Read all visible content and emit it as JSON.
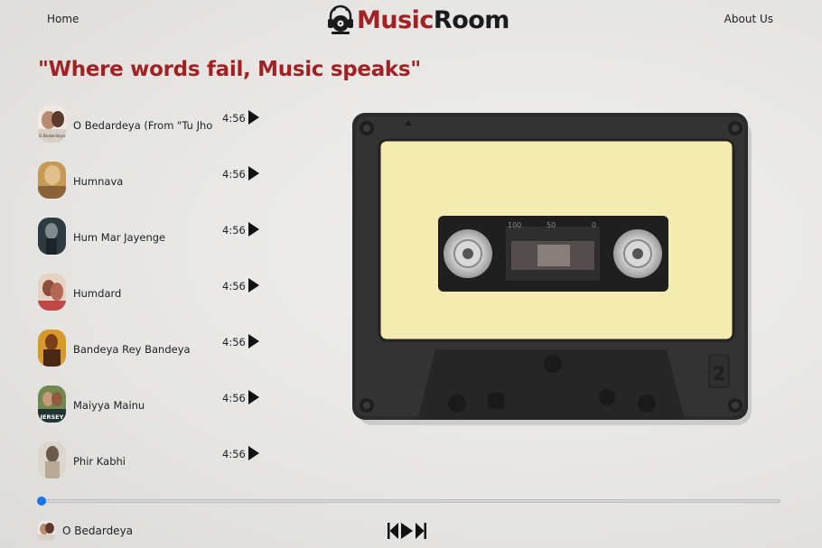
{
  "nav": {
    "home_label": "Home",
    "about_label": "About Us",
    "brand_part1": "Music",
    "brand_part2": "Room"
  },
  "quote": "\"Where words fail, Music speaks\"",
  "songs": [
    {
      "title": "O Bedardeya (From \"Tu Jhoothi Main Makkaar\")",
      "duration": "4:56"
    },
    {
      "title": "Humnava",
      "duration": "4:56"
    },
    {
      "title": "Hum Mar Jayenge",
      "duration": "4:56"
    },
    {
      "title": "Humdard",
      "duration": "4:56"
    },
    {
      "title": "Bandeya Rey Bandeya",
      "duration": "4:56"
    },
    {
      "title": "Maiyya Mainu",
      "duration": "4:56"
    },
    {
      "title": "Phir Kabhi",
      "duration": "4:56"
    }
  ],
  "cover_labels": {
    "song0": "O Bedardeya",
    "song5": "JERSEY"
  },
  "player": {
    "progress_percent": 0,
    "now_playing_title": "O Bedardeya",
    "controls": [
      "previous-icon",
      "play-icon",
      "next-icon"
    ]
  },
  "cassette": {
    "tape_scale": [
      "100",
      "50",
      "0"
    ],
    "side_number": "2"
  },
  "colors": {
    "accent": "#a12225",
    "progress": "#1a73e8",
    "label": "#f5ecb0",
    "shell": "#2a2a2a"
  }
}
